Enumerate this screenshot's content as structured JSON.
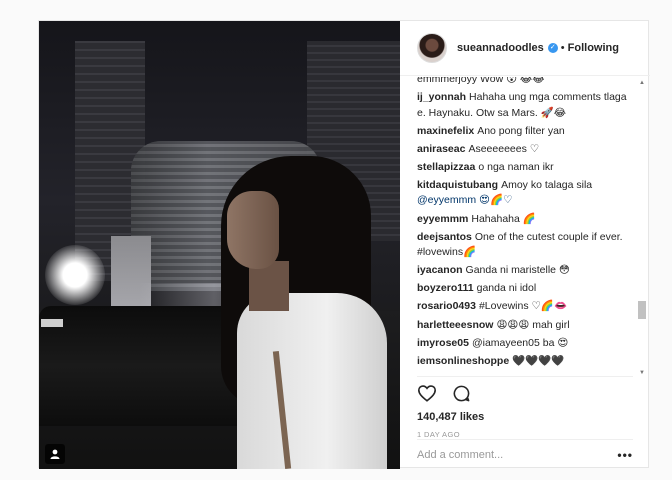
{
  "post": {
    "username": "sueannadoodles",
    "separator": "•",
    "follow_status": "Following",
    "likes": "140,487 likes",
    "time_ago": "1 DAY AGO",
    "add_comment_placeholder": "Add a comment...",
    "more_label": "•••"
  },
  "comments": [
    {
      "user": "",
      "text": "emmmerjoyy Wow 😮 😂😂"
    },
    {
      "user": "ij_yonnah",
      "text": "Hahaha ung mga comments tlaga e. Haynaku. Otw sa Mars. 🚀😂"
    },
    {
      "user": "maxinefelix",
      "text": "Ano pong filter yan"
    },
    {
      "user": "aniraseac",
      "text": "Aseeeeeees ♡"
    },
    {
      "user": "stellapizzaa",
      "text": "o nga naman ikr"
    },
    {
      "user": "kitdaquistubang",
      "text": "Amoy ko talaga sila"
    },
    {
      "user": "",
      "text": "@eyyemmm 😍🌈♡"
    },
    {
      "user": "eyyemmm",
      "text": "Hahahaha 🌈"
    },
    {
      "user": "deejsantos",
      "text": "One of the cutest couple if ever. #lovewins🌈"
    },
    {
      "user": "iyacanon",
      "text": "Ganda ni maristelle 😳"
    },
    {
      "user": "boyzero111",
      "text": "ganda ni idol"
    },
    {
      "user": "rosario0493",
      "text": "#Lovewins ♡🌈👄"
    },
    {
      "user": "harletteeesnow",
      "text": "😩😩😩 mah girl"
    },
    {
      "user": "imyrose05",
      "text": "@iamayeen05 ba 😍"
    },
    {
      "user": "iemsonlineshoppe",
      "text": "🖤🖤🖤🖤"
    }
  ],
  "icons": {
    "like": "heart-icon",
    "comment": "comment-bubble-icon",
    "verified": "verified-badge-icon",
    "tag": "user-tag-icon"
  },
  "colors": {
    "verified": "#3897f0",
    "text": "#262626",
    "muted": "#999999"
  }
}
